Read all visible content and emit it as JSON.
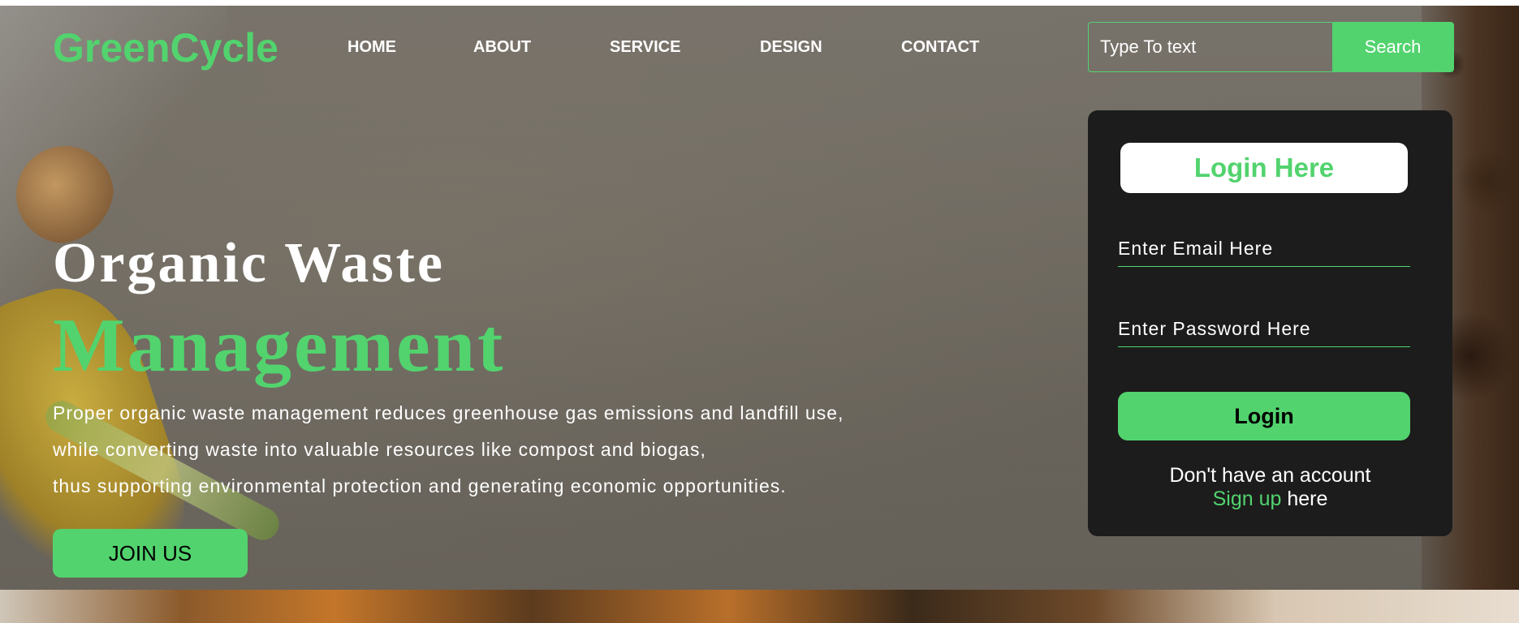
{
  "brand": {
    "name": "GreenCycle",
    "accent_color": "#52d36e"
  },
  "nav": {
    "items": [
      {
        "label": "HOME"
      },
      {
        "label": "ABOUT"
      },
      {
        "label": "SERVICE"
      },
      {
        "label": "DESIGN"
      },
      {
        "label": "CONTACT"
      }
    ]
  },
  "search": {
    "placeholder": "Type To text",
    "value": "",
    "button_label": "Search"
  },
  "hero": {
    "title_line1": "Organic Waste",
    "title_line2": "Management",
    "description_lines": [
      "Proper organic waste management reduces greenhouse gas emissions and landfill use,",
      "while converting waste into valuable resources like compost and biogas,",
      "thus supporting environmental protection and generating economic opportunities."
    ],
    "cta_label": "JOIN US"
  },
  "login": {
    "title": "Login Here",
    "email_placeholder": "Enter Email Here",
    "password_placeholder": "Enter Password Here",
    "button_label": "Login",
    "no_account_text": "Don't have an account",
    "signup_link": "Sign up",
    "signup_suffix": " here"
  }
}
